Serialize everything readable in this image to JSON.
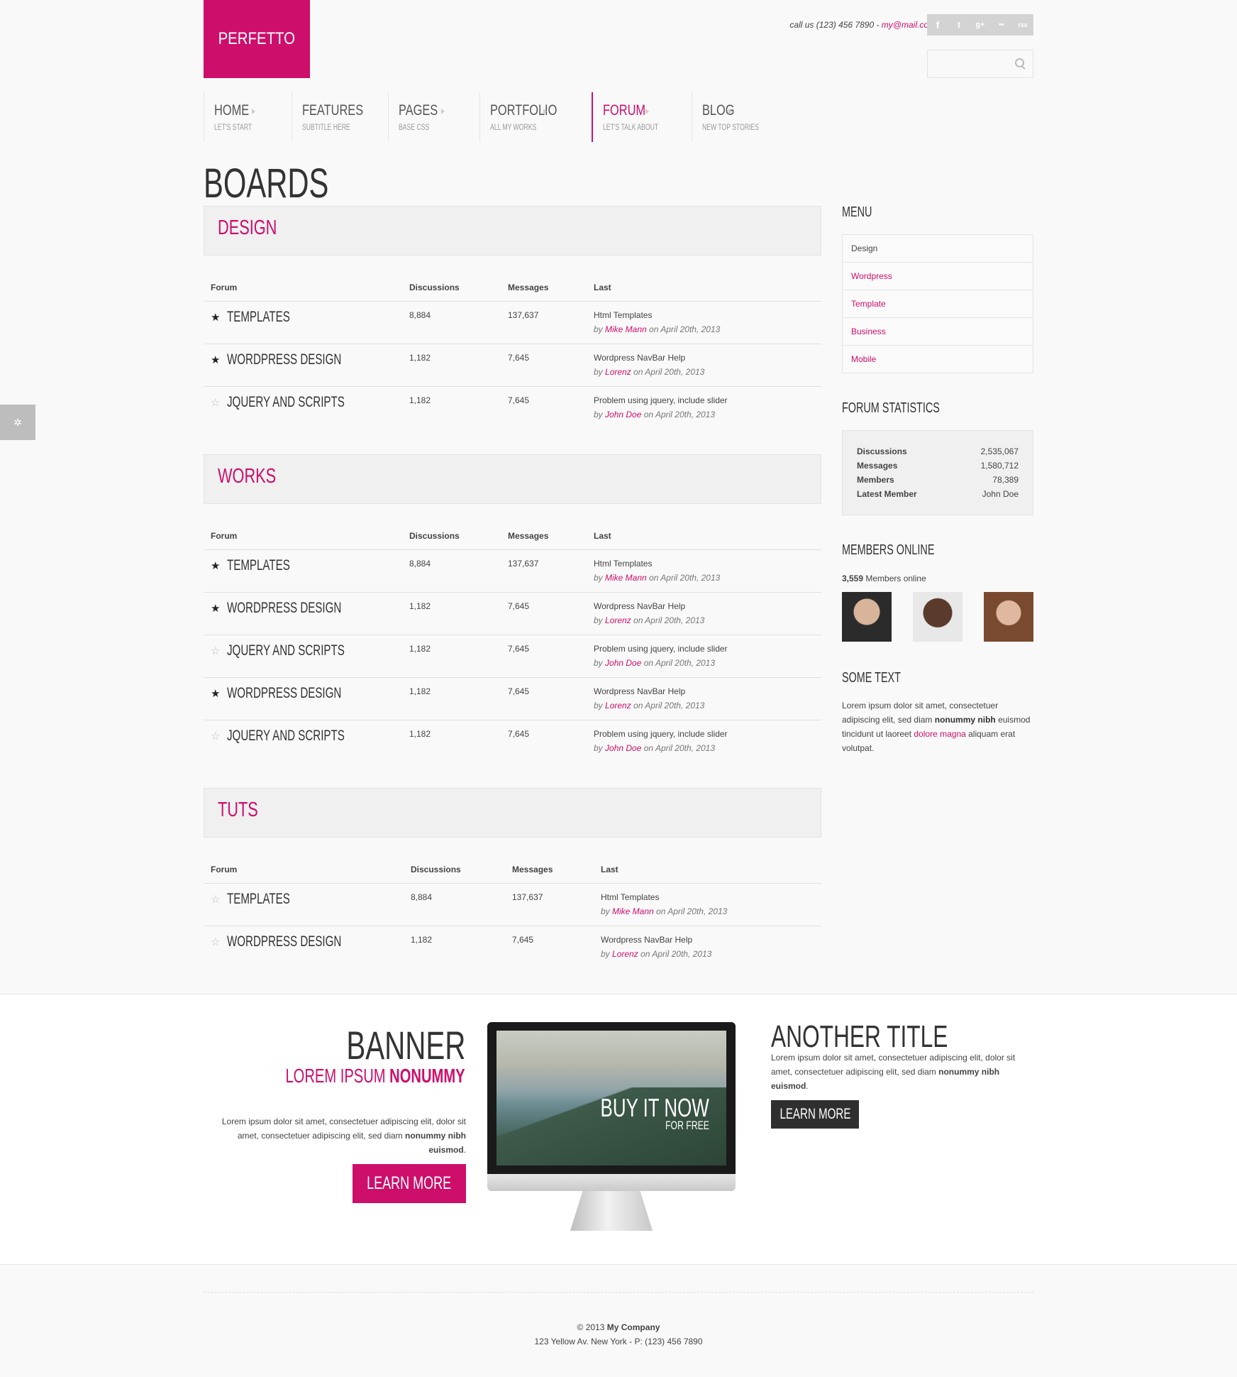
{
  "brand": {
    "logo": "PERFETTO",
    "accent": "#cd0e6b"
  },
  "header": {
    "contact_prefix": "call us (123) 456 7890 - ",
    "contact_email": "my@mail.com",
    "social": [
      "f",
      "t",
      "g+",
      "••",
      "rss"
    ]
  },
  "nav": [
    {
      "title": "HOME",
      "sub": "LET'S START"
    },
    {
      "title": "FEATURES",
      "sub": "SUBTITLE HERE"
    },
    {
      "title": "PAGES",
      "sub": "BASE CSS"
    },
    {
      "title": "PORTFOLIO",
      "sub": "ALL MY WORKS"
    },
    {
      "title": "FORUM",
      "sub": "LET'S TALK ABOUT"
    },
    {
      "title": "BLOG",
      "sub": "NEW TOP STORIES"
    }
  ],
  "page_title": "BOARDS",
  "columns": {
    "forum": "Forum",
    "discussions": "Discussions",
    "messages": "Messages",
    "last": "Last"
  },
  "boards": [
    {
      "title": "DESIGN",
      "rows": [
        {
          "name": "TEMPLATES",
          "starred": true,
          "discussions": "8,884",
          "messages": "137,637",
          "last_title": "Html Templates",
          "by": "by ",
          "author": "Mike Mann",
          "date": " on April 20th, 2013"
        },
        {
          "name": "WORDPRESS DESIGN",
          "starred": true,
          "discussions": "1,182",
          "messages": "7,645",
          "last_title": "Wordpress NavBar Help",
          "by": "by ",
          "author": "Lorenz",
          "date": " on April 20th, 2013"
        },
        {
          "name": "JQUERY AND SCRIPTS",
          "starred": false,
          "discussions": "1,182",
          "messages": "7,645",
          "last_title": "Problem using jquery, include slider",
          "by": "by ",
          "author": "John Doe",
          "date": " on April 20th, 2013"
        }
      ]
    },
    {
      "title": "WORKS",
      "rows": [
        {
          "name": "TEMPLATES",
          "starred": true,
          "discussions": "8,884",
          "messages": "137,637",
          "last_title": "Html Templates",
          "by": "by ",
          "author": "Mike Mann",
          "date": " on April 20th, 2013"
        },
        {
          "name": "WORDPRESS DESIGN",
          "starred": true,
          "discussions": "1,182",
          "messages": "7,645",
          "last_title": "Wordpress NavBar Help",
          "by": "by ",
          "author": "Lorenz",
          "date": " on April 20th, 2013"
        },
        {
          "name": "JQUERY AND SCRIPTS",
          "starred": false,
          "discussions": "1,182",
          "messages": "7,645",
          "last_title": "Problem using jquery, include slider",
          "by": "by ",
          "author": "John Doe",
          "date": " on April 20th, 2013"
        },
        {
          "name": "WORDPRESS DESIGN",
          "starred": true,
          "discussions": "1,182",
          "messages": "7,645",
          "last_title": "Wordpress NavBar Help",
          "by": "by ",
          "author": "Lorenz",
          "date": " on April 20th, 2013"
        },
        {
          "name": "JQUERY AND SCRIPTS",
          "starred": false,
          "discussions": "1,182",
          "messages": "7,645",
          "last_title": "Problem using jquery, include slider",
          "by": "by ",
          "author": "John Doe",
          "date": " on April 20th, 2013"
        }
      ]
    },
    {
      "title": "TUTS",
      "rows": [
        {
          "name": "TEMPLATES",
          "starred": false,
          "discussions": "8,884",
          "messages": "137,637",
          "last_title": "Html Templates",
          "by": "by ",
          "author": "Mike Mann",
          "date": " on April 20th, 2013"
        },
        {
          "name": "WORDPRESS DESIGN",
          "starred": false,
          "discussions": "1,182",
          "messages": "7,645",
          "last_title": "Wordpress NavBar Help",
          "by": "by ",
          "author": "Lorenz",
          "date": " on April 20th, 2013"
        }
      ]
    }
  ],
  "sidebar": {
    "menu_title": "MENU",
    "menu": [
      "Design",
      "Wordpress",
      "Template",
      "Business",
      "Mobile"
    ],
    "stats_title": "FORUM STATISTICS",
    "stats": [
      {
        "label": "Discussions",
        "value": "2,535,067"
      },
      {
        "label": "Messages",
        "value": "1,580,712"
      },
      {
        "label": "Members",
        "value": "78,389"
      },
      {
        "label": "Latest Member",
        "value": "John Doe"
      }
    ],
    "members_title": "MEMBERS ONLINE",
    "members_count": "3,559",
    "members_suffix": " Members online",
    "some_text_title": "SOME TEXT",
    "some_text_1": "Lorem ipsum dolor sit amet, consectetuer adipiscing elit, sed diam ",
    "some_text_bold": "nonummy nibh",
    "some_text_2": " euismod tincidunt ut laoreet ",
    "some_text_pink": "dolore magna",
    "some_text_3": " aliquam erat volutpat."
  },
  "banner": {
    "title": "BANNER",
    "sub_a": "LOREM IPSUM ",
    "sub_b": "NONUMMY",
    "text_a": "Lorem ipsum dolor sit amet, consectetuer adipiscing elit, dolor sit amet, consectetuer adipiscing elit, sed diam ",
    "text_b": "nonummy nibh euismod",
    "text_c": ".",
    "button": "LEARN MORE",
    "screen_title": "BUY IT NOW",
    "screen_sub": "FOR FREE"
  },
  "another": {
    "title": "ANOTHER TITLE",
    "text_a": "Lorem ipsum dolor sit amet, consectetuer adipiscing elit, dolor sit amet, consectetuer adipiscing elit, sed diam ",
    "text_b": "nonummy nibh euismod",
    "text_c": ".",
    "button": "LEARN MORE"
  },
  "footer": {
    "line1_a": "© 2013 ",
    "line1_b": "My Company",
    "line2": "123 Yellow Av. New York - P: (123) 456 7890"
  }
}
